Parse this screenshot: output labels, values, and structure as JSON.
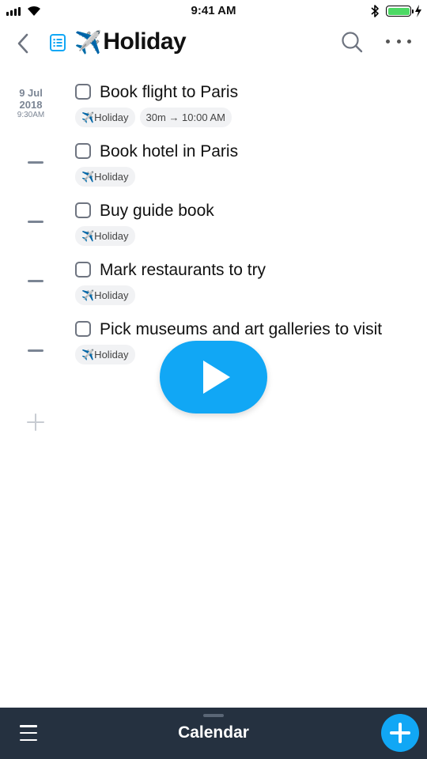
{
  "status_bar": {
    "time": "9:41 AM",
    "battery_level": 1.0
  },
  "header": {
    "title_emoji": "✈️",
    "title": "Holiday"
  },
  "date": {
    "day_month": "9 Jul",
    "year": "2018",
    "time": "9:30AM"
  },
  "tasks": [
    {
      "title": "Book flight to Paris",
      "tags": [
        "✈️Holiday",
        "30m → 10:00 AM"
      ]
    },
    {
      "title": "Book hotel in Paris",
      "tags": [
        "✈️Holiday"
      ]
    },
    {
      "title": "Buy guide book",
      "tags": [
        "✈️Holiday"
      ]
    },
    {
      "title": "Mark restaurants to try",
      "tags": [
        "✈️Holiday"
      ]
    },
    {
      "title": "Pick museums and art galleries to visit",
      "tags": [
        "✈️Holiday"
      ]
    }
  ],
  "bottom_bar": {
    "title": "Calendar"
  },
  "colors": {
    "accent": "#11a7f5",
    "bottom_bar": "#253140",
    "muted": "#7b8594"
  },
  "icons": [
    "signal-icon",
    "wifi-icon",
    "bluetooth-icon",
    "battery-icon",
    "back-icon",
    "list-icon",
    "search-icon",
    "more-icon",
    "play-icon",
    "menu-icon",
    "plus-icon"
  ]
}
